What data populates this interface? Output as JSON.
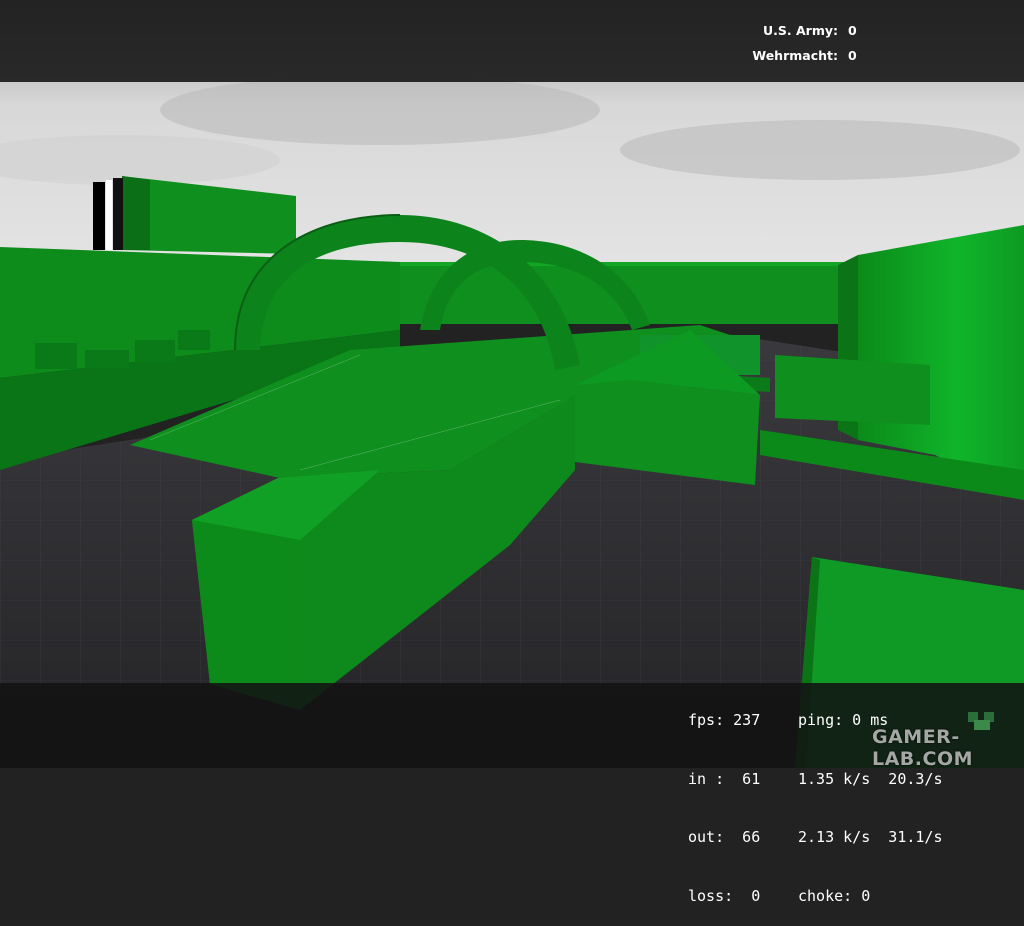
{
  "scoreboard": {
    "teams": [
      {
        "name": "U.S. Army:",
        "score": "0"
      },
      {
        "name": "Wehrmacht:",
        "score": "0"
      }
    ]
  },
  "net_graph": {
    "fps": "fps: 237",
    "ping": "ping: 0 ms",
    "in": "in :  61",
    "in_rate": "1.35 k/s  20.3/s",
    "out": "out:  66",
    "out_rate": "2.13 k/s  31.1/s",
    "loss": "loss:  0",
    "choke": "choke: 0"
  },
  "watermark": {
    "text": "GAMER-LAB.COM"
  },
  "colors": {
    "geometry": "#0f8f1e",
    "geometry_dark": "#0a6f16",
    "floor": "#2b2b2f",
    "hud_bar": "#121212",
    "sky": "#c9c9c9"
  }
}
